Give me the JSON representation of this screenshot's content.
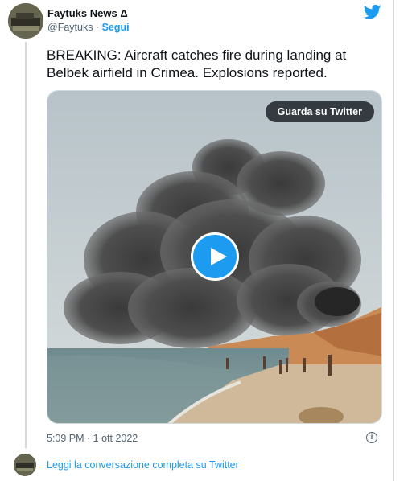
{
  "header": {
    "name": "Faytuks News Δ",
    "handle": "@Faytuks",
    "separator": " · ",
    "follow_label": "Segui"
  },
  "tweet": {
    "text": "BREAKING: Aircraft catches fire during landing at Belbek airfield in Crimea. Explosions reported.",
    "timestamp": "5:09 PM · 1 ott 2022"
  },
  "media": {
    "watch_label": "Guarda su Twitter"
  },
  "footer": {
    "thread_link": "Leggi la conversazione completa su Twitter"
  },
  "colors": {
    "accent": "#1d9bf0",
    "text": "#0f1419",
    "muted": "#536471",
    "border": "#cfd9de"
  }
}
